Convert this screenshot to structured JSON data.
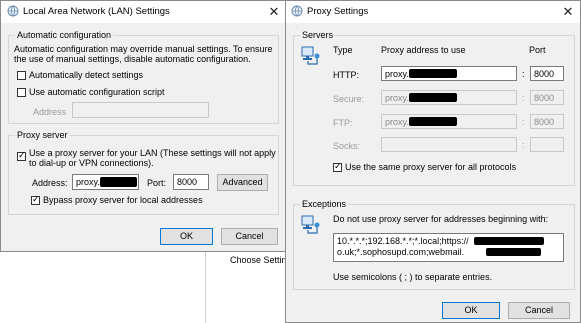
{
  "lan": {
    "title": "Local Area Network (LAN) Settings",
    "auto_config": {
      "legend": "Automatic configuration",
      "description": "Automatic configuration may override manual settings.  To ensure the use of manual settings, disable automatic configuration.",
      "auto_detect_label": "Automatically detect settings",
      "auto_detect_checked": false,
      "use_script_label": "Use automatic configuration script",
      "use_script_checked": false,
      "address_label": "Address",
      "address_value": ""
    },
    "proxy_server": {
      "legend": "Proxy server",
      "use_proxy_label": "Use a proxy server for your LAN (These settings will not apply to dial-up or VPN connections).",
      "use_proxy_checked": true,
      "address_label": "Address:",
      "address_value": "proxy.",
      "port_label": "Port:",
      "port_value": "8000",
      "advanced_label": "Advanced",
      "bypass_label": "Bypass proxy server for local addresses",
      "bypass_checked": true
    },
    "ok_label": "OK",
    "cancel_label": "Cancel"
  },
  "background": {
    "choose_settings_text": "Choose Setting"
  },
  "proxy": {
    "title": "Proxy Settings",
    "servers": {
      "legend": "Servers",
      "type_header": "Type",
      "address_header": "Proxy address to use",
      "port_header": "Port",
      "rows": [
        {
          "type": "HTTP:",
          "address": "proxy.",
          "port": "8000",
          "enabled": true
        },
        {
          "type": "Secure:",
          "address": "proxy.",
          "port": "8000",
          "enabled": false
        },
        {
          "type": "FTP:",
          "address": "proxy.",
          "port": "8000",
          "enabled": false
        },
        {
          "type": "Socks:",
          "address": "",
          "port": "",
          "enabled": false
        }
      ],
      "colon": ":",
      "same_proxy_label": "Use the same proxy server for all protocols",
      "same_proxy_checked": true
    },
    "exceptions": {
      "legend": "Exceptions",
      "description": "Do not use proxy server for addresses beginning with:",
      "line1": "10.*.*.*;192.168.*.*;*.local;https://",
      "line2": "o.uk;*.sophosupd.com;webmail.",
      "hint": "Use semicolons ( ; ) to separate entries."
    },
    "ok_label": "OK",
    "cancel_label": "Cancel"
  },
  "colors": {
    "dialog_bg": "#f0f0f0",
    "accent": "#0078d7",
    "icon_blue": "#2b6cb0"
  }
}
